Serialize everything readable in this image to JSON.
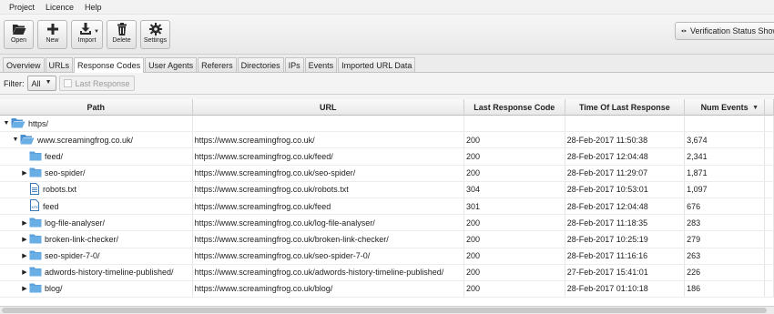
{
  "menu": [
    "Project",
    "Licence",
    "Help"
  ],
  "toolbar": {
    "open": "Open",
    "new": "New",
    "import": "Import",
    "delete": "Delete",
    "settings": "Settings",
    "verification": "Verification Status Show"
  },
  "tabs": [
    "Overview",
    "URLs",
    "Response Codes",
    "User Agents",
    "Referers",
    "Directories",
    "IPs",
    "Events",
    "Imported URL Data"
  ],
  "active_tab": "Response Codes",
  "filter": {
    "label": "Filter:",
    "value": "All",
    "last_response": "Last Response"
  },
  "columns": [
    "Path",
    "URL",
    "Last Response Code",
    "Time Of Last Response",
    "Num Events"
  ],
  "rows": [
    {
      "path": "https/",
      "url": "",
      "code": "",
      "time": "",
      "events": "",
      "indent": 0,
      "expand": "open",
      "icon": "folder-open-icon"
    },
    {
      "path": "www.screamingfrog.co.uk/",
      "url": "https://www.screamingfrog.co.uk/",
      "code": "200",
      "time": "28-Feb-2017 11:50:38",
      "events": "3,674",
      "indent": 1,
      "expand": "open",
      "icon": "folder-open-icon"
    },
    {
      "path": "feed/",
      "url": "https://www.screamingfrog.co.uk/feed/",
      "code": "200",
      "time": "28-Feb-2017 12:04:48",
      "events": "2,341",
      "indent": 2,
      "expand": "none",
      "icon": "folder-icon"
    },
    {
      "path": "seo-spider/",
      "url": "https://www.screamingfrog.co.uk/seo-spider/",
      "code": "200",
      "time": "28-Feb-2017 11:29:07",
      "events": "1,871",
      "indent": 2,
      "expand": "closed",
      "icon": "folder-icon"
    },
    {
      "path": "robots.txt",
      "url": "https://www.screamingfrog.co.uk/robots.txt",
      "code": "304",
      "time": "28-Feb-2017 10:53:01",
      "events": "1,097",
      "indent": 2,
      "expand": "none",
      "icon": "text-file-icon"
    },
    {
      "path": "feed",
      "url": "https://www.screamingfrog.co.uk/feed",
      "code": "301",
      "time": "28-Feb-2017 12:04:48",
      "events": "676",
      "indent": 2,
      "expand": "none",
      "icon": "xml-file-icon"
    },
    {
      "path": "log-file-analyser/",
      "url": "https://www.screamingfrog.co.uk/log-file-analyser/",
      "code": "200",
      "time": "28-Feb-2017 11:18:35",
      "events": "283",
      "indent": 2,
      "expand": "closed",
      "icon": "folder-icon"
    },
    {
      "path": "broken-link-checker/",
      "url": "https://www.screamingfrog.co.uk/broken-link-checker/",
      "code": "200",
      "time": "28-Feb-2017 10:25:19",
      "events": "279",
      "indent": 2,
      "expand": "closed",
      "icon": "folder-icon"
    },
    {
      "path": "seo-spider-7-0/",
      "url": "https://www.screamingfrog.co.uk/seo-spider-7-0/",
      "code": "200",
      "time": "28-Feb-2017 11:16:16",
      "events": "263",
      "indent": 2,
      "expand": "closed",
      "icon": "folder-icon"
    },
    {
      "path": "adwords-history-timeline-published/",
      "url": "https://www.screamingfrog.co.uk/adwords-history-timeline-published/",
      "code": "200",
      "time": "27-Feb-2017 15:41:01",
      "events": "226",
      "indent": 2,
      "expand": "closed",
      "icon": "folder-icon"
    },
    {
      "path": "blog/",
      "url": "https://www.screamingfrog.co.uk/blog/",
      "code": "200",
      "time": "28-Feb-2017 01:10:18",
      "events": "186",
      "indent": 2,
      "expand": "closed",
      "icon": "folder-icon"
    }
  ]
}
